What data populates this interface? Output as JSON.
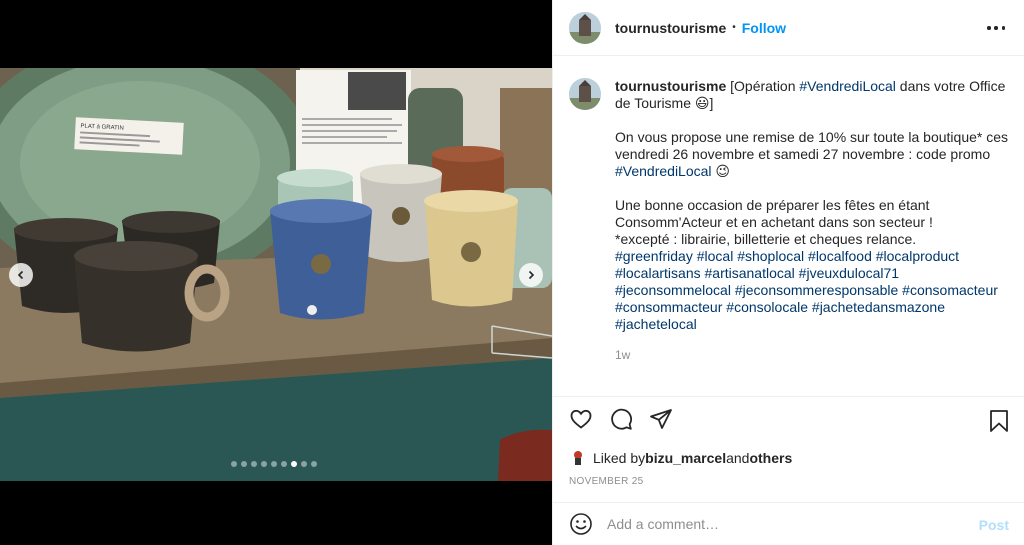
{
  "post": {
    "media": {
      "image_alt": "Photo of handmade ceramic mugs and a plate on a wooden shelf",
      "slide_count": 9,
      "active_slide": 6,
      "sign_heading": "PLAT à GRATIN"
    },
    "header": {
      "username": "tournustourisme",
      "separator": "•",
      "follow_label": "Follow"
    },
    "caption": {
      "username": "tournustourisme",
      "intro_before": " [Opération ",
      "intro_tag": "#VendrediLocal",
      "intro_after": " dans votre Office de Tourisme 😃]",
      "para2_before": "On vous propose une remise de 10% sur toute la boutique* ces vendredi 26 novembre et samedi 27 novembre : code promo ",
      "para2_tag": "#VendrediLocal",
      "para2_after": " 😉",
      "para3": "Une bonne occasion de préparer les fêtes en étant Consomm'Acteur et en achetant dans son secteur !\n*excepté : librairie, billetterie et cheques relance.",
      "hashtags": [
        "#greenfriday",
        "#local",
        "#shoplocal",
        "#localfood",
        "#localproduct",
        "#localartisans",
        "#artisanatlocal",
        "#jveuxdulocal71",
        "#jeconsommelocal",
        "#jeconsommeresponsable",
        "#consomacteur",
        "#consommacteur",
        "#consolocale",
        "#jachetedansmazone",
        "#jachetelocal"
      ],
      "time": "1w"
    },
    "likes": {
      "prefix": "Liked by ",
      "liker": "bizu_marcel",
      "and": " and ",
      "others": "others"
    },
    "date": "NOVEMBER 25",
    "comment": {
      "placeholder": "Add a comment…",
      "post_label": "Post"
    },
    "icons": [
      "heart-icon",
      "comment-icon",
      "share-icon",
      "bookmark-icon",
      "emoji-icon",
      "more-icon",
      "chevron-left-icon",
      "chevron-right-icon"
    ],
    "colors": {
      "link": "#0095f6",
      "hashtag": "#00376b",
      "muted": "#8e8e8e",
      "post_disabled": "#b2dffc"
    }
  }
}
